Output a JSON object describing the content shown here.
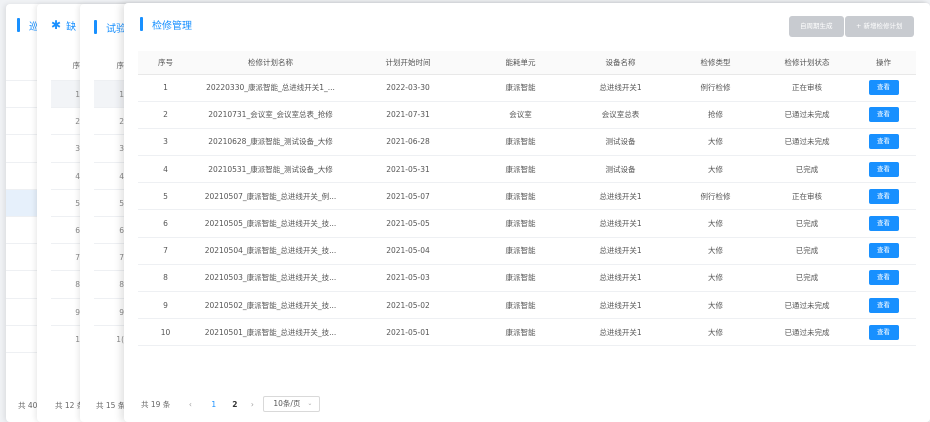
{
  "background_panels": [
    {
      "title": "巡",
      "rows": [
        "",
        "",
        "",
        "",
        "",
        "",
        "",
        "",
        "",
        "",
        ""
      ],
      "footer": "共 40"
    },
    {
      "title": "缺",
      "header_label": "序",
      "rows": [
        "1",
        "2",
        "3",
        "4",
        "5",
        "6",
        "7",
        "8",
        "9",
        "1"
      ],
      "footer": "共 12 条"
    },
    {
      "title": "试验",
      "header_label": "序",
      "rows": [
        "1",
        "2",
        "3",
        "4",
        "5",
        "6",
        "7",
        "8",
        "9",
        "1("
      ],
      "footer": "共 15 条"
    }
  ],
  "main": {
    "title": "检修管理",
    "buttons": {
      "auto_generate": "自周期生成",
      "add_plan": "+ 新增检修计划"
    },
    "columns": [
      "序号",
      "检修计划名称",
      "计划开始时间",
      "能耗单元",
      "设备名称",
      "检修类型",
      "检修计划状态",
      "操作"
    ],
    "action_label": "查看",
    "rows": [
      {
        "no": "1",
        "name": "20220330_康派智能_总进线开关1_...",
        "start": "2022-03-30",
        "unit": "康派智能",
        "device": "总进线开关1",
        "type": "例行检修",
        "status": "正在审核"
      },
      {
        "no": "2",
        "name": "20210731_会议室_会议室总表_抢修",
        "start": "2021-07-31",
        "unit": "会议室",
        "device": "会议室总表",
        "type": "抢修",
        "status": "已通过未完成"
      },
      {
        "no": "3",
        "name": "20210628_康派智能_测试设备_大修",
        "start": "2021-06-28",
        "unit": "康派智能",
        "device": "测试设备",
        "type": "大修",
        "status": "已通过未完成"
      },
      {
        "no": "4",
        "name": "20210531_康派智能_测试设备_大修",
        "start": "2021-05-31",
        "unit": "康派智能",
        "device": "测试设备",
        "type": "大修",
        "status": "已完成"
      },
      {
        "no": "5",
        "name": "20210507_康派智能_总进线开关_例...",
        "start": "2021-05-07",
        "unit": "康派智能",
        "device": "总进线开关1",
        "type": "例行检修",
        "status": "正在审核"
      },
      {
        "no": "6",
        "name": "20210505_康派智能_总进线开关_技...",
        "start": "2021-05-05",
        "unit": "康派智能",
        "device": "总进线开关1",
        "type": "大修",
        "status": "已完成"
      },
      {
        "no": "7",
        "name": "20210504_康派智能_总进线开关_技...",
        "start": "2021-05-04",
        "unit": "康派智能",
        "device": "总进线开关1",
        "type": "大修",
        "status": "已完成"
      },
      {
        "no": "8",
        "name": "20210503_康派智能_总进线开关_技...",
        "start": "2021-05-03",
        "unit": "康派智能",
        "device": "总进线开关1",
        "type": "大修",
        "status": "已完成"
      },
      {
        "no": "9",
        "name": "20210502_康派智能_总进线开关_技...",
        "start": "2021-05-02",
        "unit": "康派智能",
        "device": "总进线开关1",
        "type": "大修",
        "status": "已通过未完成"
      },
      {
        "no": "10",
        "name": "20210501_康派智能_总进线开关_技...",
        "start": "2021-05-01",
        "unit": "康派智能",
        "device": "总进线开关1",
        "type": "大修",
        "status": "已通过未完成"
      }
    ],
    "pagination": {
      "total": "共 19 条",
      "prev": "‹",
      "pages": [
        "1",
        "2"
      ],
      "current_page": "1",
      "next": "›",
      "page_size": "10条/页",
      "page_size_chevron": "⌄"
    }
  },
  "colors": {
    "accent": "#1890ff",
    "disabled_button": "#c8cbd0"
  }
}
